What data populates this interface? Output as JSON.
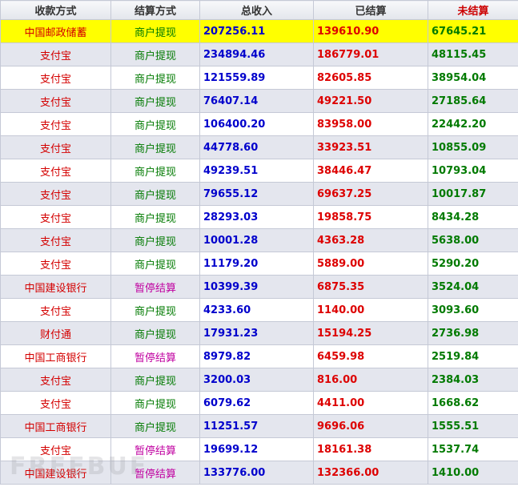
{
  "headers": {
    "method": "收款方式",
    "settle_type": "结算方式",
    "total_income": "总收入",
    "settled": "已结算",
    "unsettled": "未结算"
  },
  "rows": [
    {
      "method": "中国邮政储蓄",
      "settle_type": "商户提现",
      "total_income": "207256.11",
      "settled": "139610.90",
      "unsettled": "67645.21"
    },
    {
      "method": "支付宝",
      "settle_type": "商户提现",
      "total_income": "234894.46",
      "settled": "186779.01",
      "unsettled": "48115.45"
    },
    {
      "method": "支付宝",
      "settle_type": "商户提现",
      "total_income": "121559.89",
      "settled": "82605.85",
      "unsettled": "38954.04"
    },
    {
      "method": "支付宝",
      "settle_type": "商户提现",
      "total_income": "76407.14",
      "settled": "49221.50",
      "unsettled": "27185.64"
    },
    {
      "method": "支付宝",
      "settle_type": "商户提现",
      "total_income": "106400.20",
      "settled": "83958.00",
      "unsettled": "22442.20"
    },
    {
      "method": "支付宝",
      "settle_type": "商户提现",
      "total_income": "44778.60",
      "settled": "33923.51",
      "unsettled": "10855.09"
    },
    {
      "method": "支付宝",
      "settle_type": "商户提现",
      "total_income": "49239.51",
      "settled": "38446.47",
      "unsettled": "10793.04"
    },
    {
      "method": "支付宝",
      "settle_type": "商户提现",
      "total_income": "79655.12",
      "settled": "69637.25",
      "unsettled": "10017.87"
    },
    {
      "method": "支付宝",
      "settle_type": "商户提现",
      "total_income": "28293.03",
      "settled": "19858.75",
      "unsettled": "8434.28"
    },
    {
      "method": "支付宝",
      "settle_type": "商户提现",
      "total_income": "10001.28",
      "settled": "4363.28",
      "unsettled": "5638.00"
    },
    {
      "method": "支付宝",
      "settle_type": "商户提现",
      "total_income": "11179.20",
      "settled": "5889.00",
      "unsettled": "5290.20"
    },
    {
      "method": "中国建设银行",
      "settle_type": "暂停结算",
      "total_income": "10399.39",
      "settled": "6875.35",
      "unsettled": "3524.04"
    },
    {
      "method": "支付宝",
      "settle_type": "商户提现",
      "total_income": "4233.60",
      "settled": "1140.00",
      "unsettled": "3093.60"
    },
    {
      "method": "财付通",
      "settle_type": "商户提现",
      "total_income": "17931.23",
      "settled": "15194.25",
      "unsettled": "2736.98"
    },
    {
      "method": "中国工商银行",
      "settle_type": "暂停结算",
      "total_income": "8979.82",
      "settled": "6459.98",
      "unsettled": "2519.84"
    },
    {
      "method": "支付宝",
      "settle_type": "商户提现",
      "total_income": "3200.03",
      "settled": "816.00",
      "unsettled": "2384.03"
    },
    {
      "method": "支付宝",
      "settle_type": "商户提现",
      "total_income": "6079.62",
      "settled": "4411.00",
      "unsettled": "1668.62"
    },
    {
      "method": "中国工商银行",
      "settle_type": "商户提现",
      "total_income": "11251.57",
      "settled": "9696.06",
      "unsettled": "1555.51"
    },
    {
      "method": "支付宝",
      "settle_type": "暂停结算",
      "total_income": "19699.12",
      "settled": "18161.38",
      "unsettled": "1537.74"
    },
    {
      "method": "中国建设银行",
      "settle_type": "暂停结算",
      "total_income": "133776.00",
      "settled": "132366.00",
      "unsettled": "1410.00"
    }
  ],
  "watermark": "FREEBUF",
  "colors": {
    "highlight_row": "#ffff00",
    "alt_row": "#e4e6ee",
    "method_text": "#d40000",
    "merchant_withdraw_text": "#007a00",
    "paused_text": "#c000a0",
    "income_text": "#0000cc",
    "settled_text": "#dd0000",
    "unsettled_text": "#007a00"
  }
}
